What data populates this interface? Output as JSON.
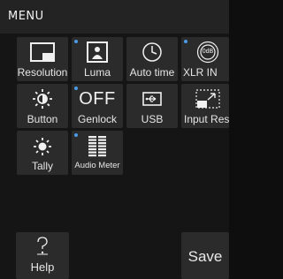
{
  "header": {
    "title": "MENU"
  },
  "tiles": [
    {
      "label": "Resolution",
      "icon": "resolution-icon",
      "dot": false
    },
    {
      "label": "Luma",
      "icon": "luma-icon",
      "dot": true
    },
    {
      "label": "Auto time",
      "icon": "clock-icon",
      "dot": false
    },
    {
      "label": "XLR IN",
      "icon": "xlr-icon",
      "dot": true,
      "icon_text": "0dB"
    },
    {
      "label": "Button",
      "icon": "brightness-icon",
      "dot": false
    },
    {
      "label": "Genlock",
      "icon": "genlock-icon",
      "dot": true,
      "icon_text": "OFF"
    },
    {
      "label": "USB",
      "icon": "usb-icon",
      "dot": false
    },
    {
      "label": "Input Res",
      "icon": "input-res-icon",
      "dot": false
    },
    {
      "label": "Tally",
      "icon": "tally-icon",
      "dot": false
    },
    {
      "label": "Audio Meter",
      "icon": "audio-meter-icon",
      "dot": true
    }
  ],
  "footer": {
    "help_label": "Help",
    "help_icon": "question-mark-icon",
    "save_label": "Save"
  },
  "colors": {
    "accent_dot": "#4a9be8",
    "tile_bg": "#2b2b2b",
    "header_bg": "#232323",
    "panel_bg": "#151515"
  }
}
